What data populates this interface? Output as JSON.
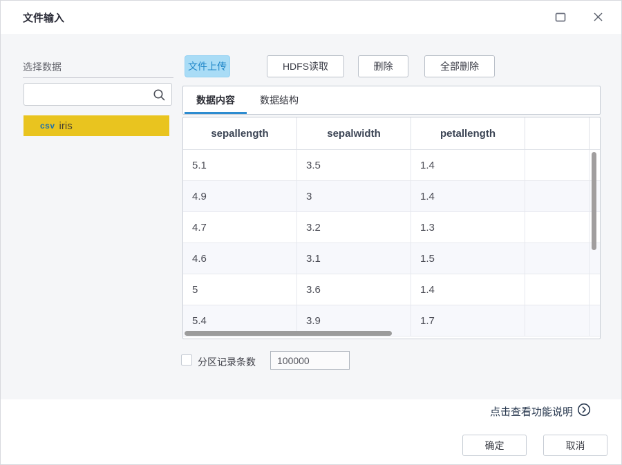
{
  "window": {
    "title": "文件输入"
  },
  "sidebar": {
    "section_label": "选择数据",
    "items": [
      {
        "badge": "csv",
        "name": "iris",
        "selected": true
      }
    ]
  },
  "toolbar": {
    "buttons": [
      {
        "label": "文件上传",
        "active": true
      },
      {
        "label": "HDFS读取",
        "active": false
      },
      {
        "label": "删除",
        "active": false
      },
      {
        "label": "全部删除",
        "active": false
      }
    ]
  },
  "tabs": [
    {
      "label": "数据内容",
      "active": true
    },
    {
      "label": "数据结构",
      "active": false
    }
  ],
  "table": {
    "columns": [
      "sepallength",
      "sepalwidth",
      "petallength"
    ],
    "rows": [
      [
        "5.1",
        "3.5",
        "1.4"
      ],
      [
        "4.9",
        "3",
        "1.4"
      ],
      [
        "4.7",
        "3.2",
        "1.3"
      ],
      [
        "4.6",
        "3.1",
        "1.5"
      ],
      [
        "5",
        "3.6",
        "1.4"
      ],
      [
        "5.4",
        "3.9",
        "1.7"
      ]
    ]
  },
  "partition": {
    "label": "分区记录条数",
    "value": "100000",
    "checked": false
  },
  "help": {
    "label": "点击查看功能说明"
  },
  "footer": {
    "ok_label": "确定",
    "cancel_label": "取消"
  },
  "colors": {
    "accent_blue": "#2d8cd0",
    "active_button_bg": "#a9dcf6",
    "active_button_text": "#1f86c8",
    "selected_item_bg": "#e9c41f",
    "csv_badge_text": "#1c6fae",
    "body_bg": "#f5f6f8"
  }
}
